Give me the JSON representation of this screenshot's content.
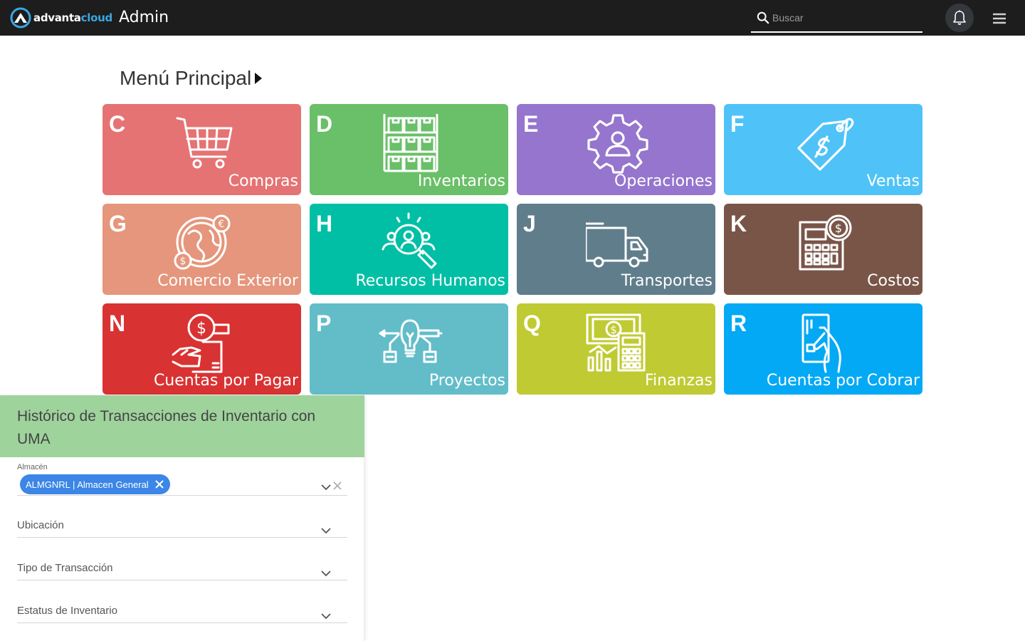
{
  "topbar": {
    "logo_part1": "advanta",
    "logo_part2": "cloud",
    "app_title": "Admin",
    "search_placeholder": "Buscar",
    "icons": {
      "search": "search-icon",
      "bell": "bell-icon",
      "menu": "hamburger-menu-icon"
    }
  },
  "menu": {
    "title": "Menú Principal",
    "tiles": [
      {
        "letter": "C",
        "label": "Compras",
        "color": "#e57373",
        "icon": "shopping-cart-icon"
      },
      {
        "letter": "D",
        "label": "Inventarios",
        "color": "#6abf69",
        "icon": "boxes-shelf-icon"
      },
      {
        "letter": "E",
        "label": "Operaciones",
        "color": "#9575cd",
        "icon": "gear-person-icon"
      },
      {
        "letter": "F",
        "label": "Ventas",
        "color": "#4fc3f7",
        "icon": "price-tag-icon"
      },
      {
        "letter": "G",
        "label": "Comercio Exterior",
        "color": "#e5967c",
        "icon": "globe-currency-icon"
      },
      {
        "letter": "H",
        "label": "Recursos Humanos",
        "color": "#00bfa5",
        "icon": "magnifier-people-icon"
      },
      {
        "letter": "J",
        "label": "Transportes",
        "color": "#607d8b",
        "icon": "truck-icon"
      },
      {
        "letter": "K",
        "label": "Costos",
        "color": "#795548",
        "icon": "calculator-dollar-icon"
      },
      {
        "letter": "N",
        "label": "Cuentas por Pagar",
        "color": "#d93232",
        "icon": "hand-coin-icon"
      },
      {
        "letter": "P",
        "label": "Proyectos",
        "color": "#62bdc9",
        "icon": "lightbulb-project-icon"
      },
      {
        "letter": "Q",
        "label": "Finanzas",
        "color": "#c0ca33",
        "icon": "finance-calculator-icon"
      },
      {
        "letter": "R",
        "label": "Cuentas por Cobrar",
        "color": "#03a9f4",
        "icon": "hand-card-icon"
      }
    ]
  },
  "panel": {
    "title": "Histórico de Transacciones de Inventario con UMA",
    "header_color": "#9ed39c",
    "almacen_label": "Almacén",
    "almacen_chip": "ALMGNRL | Almacen General",
    "ubicacion_label": "Ubicación",
    "tipo_label": "Tipo de Transacción",
    "estatus_label": "Estatus de Inventario"
  }
}
